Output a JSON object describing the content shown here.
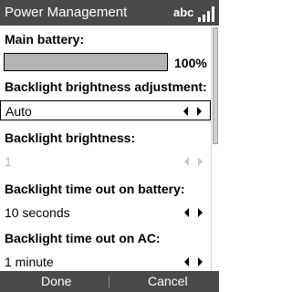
{
  "window": {
    "title": "Power Management",
    "input_mode": "abc",
    "signal_icon": "signal-strength-icon"
  },
  "battery": {
    "label": "Main battery:",
    "percent_text": "100%",
    "level": 1.0
  },
  "brightness_adjustment": {
    "label": "Backlight brightness adjustment:",
    "value": "Auto",
    "arrow_icons": "left-right-arrow-icon"
  },
  "brightness": {
    "label": "Backlight brightness:",
    "value": "1",
    "disabled": true
  },
  "timeout_battery": {
    "label": "Backlight time out on battery:",
    "value": "10 seconds"
  },
  "timeout_ac": {
    "label": "Backlight time out on AC:",
    "value": "1 minute"
  },
  "softkeys": {
    "left": "Done",
    "right": "Cancel"
  },
  "colors": {
    "bar_background": "#4a4a4a",
    "battery_fill": "#b3b3b3",
    "disabled_text": "#bdbdbd"
  }
}
